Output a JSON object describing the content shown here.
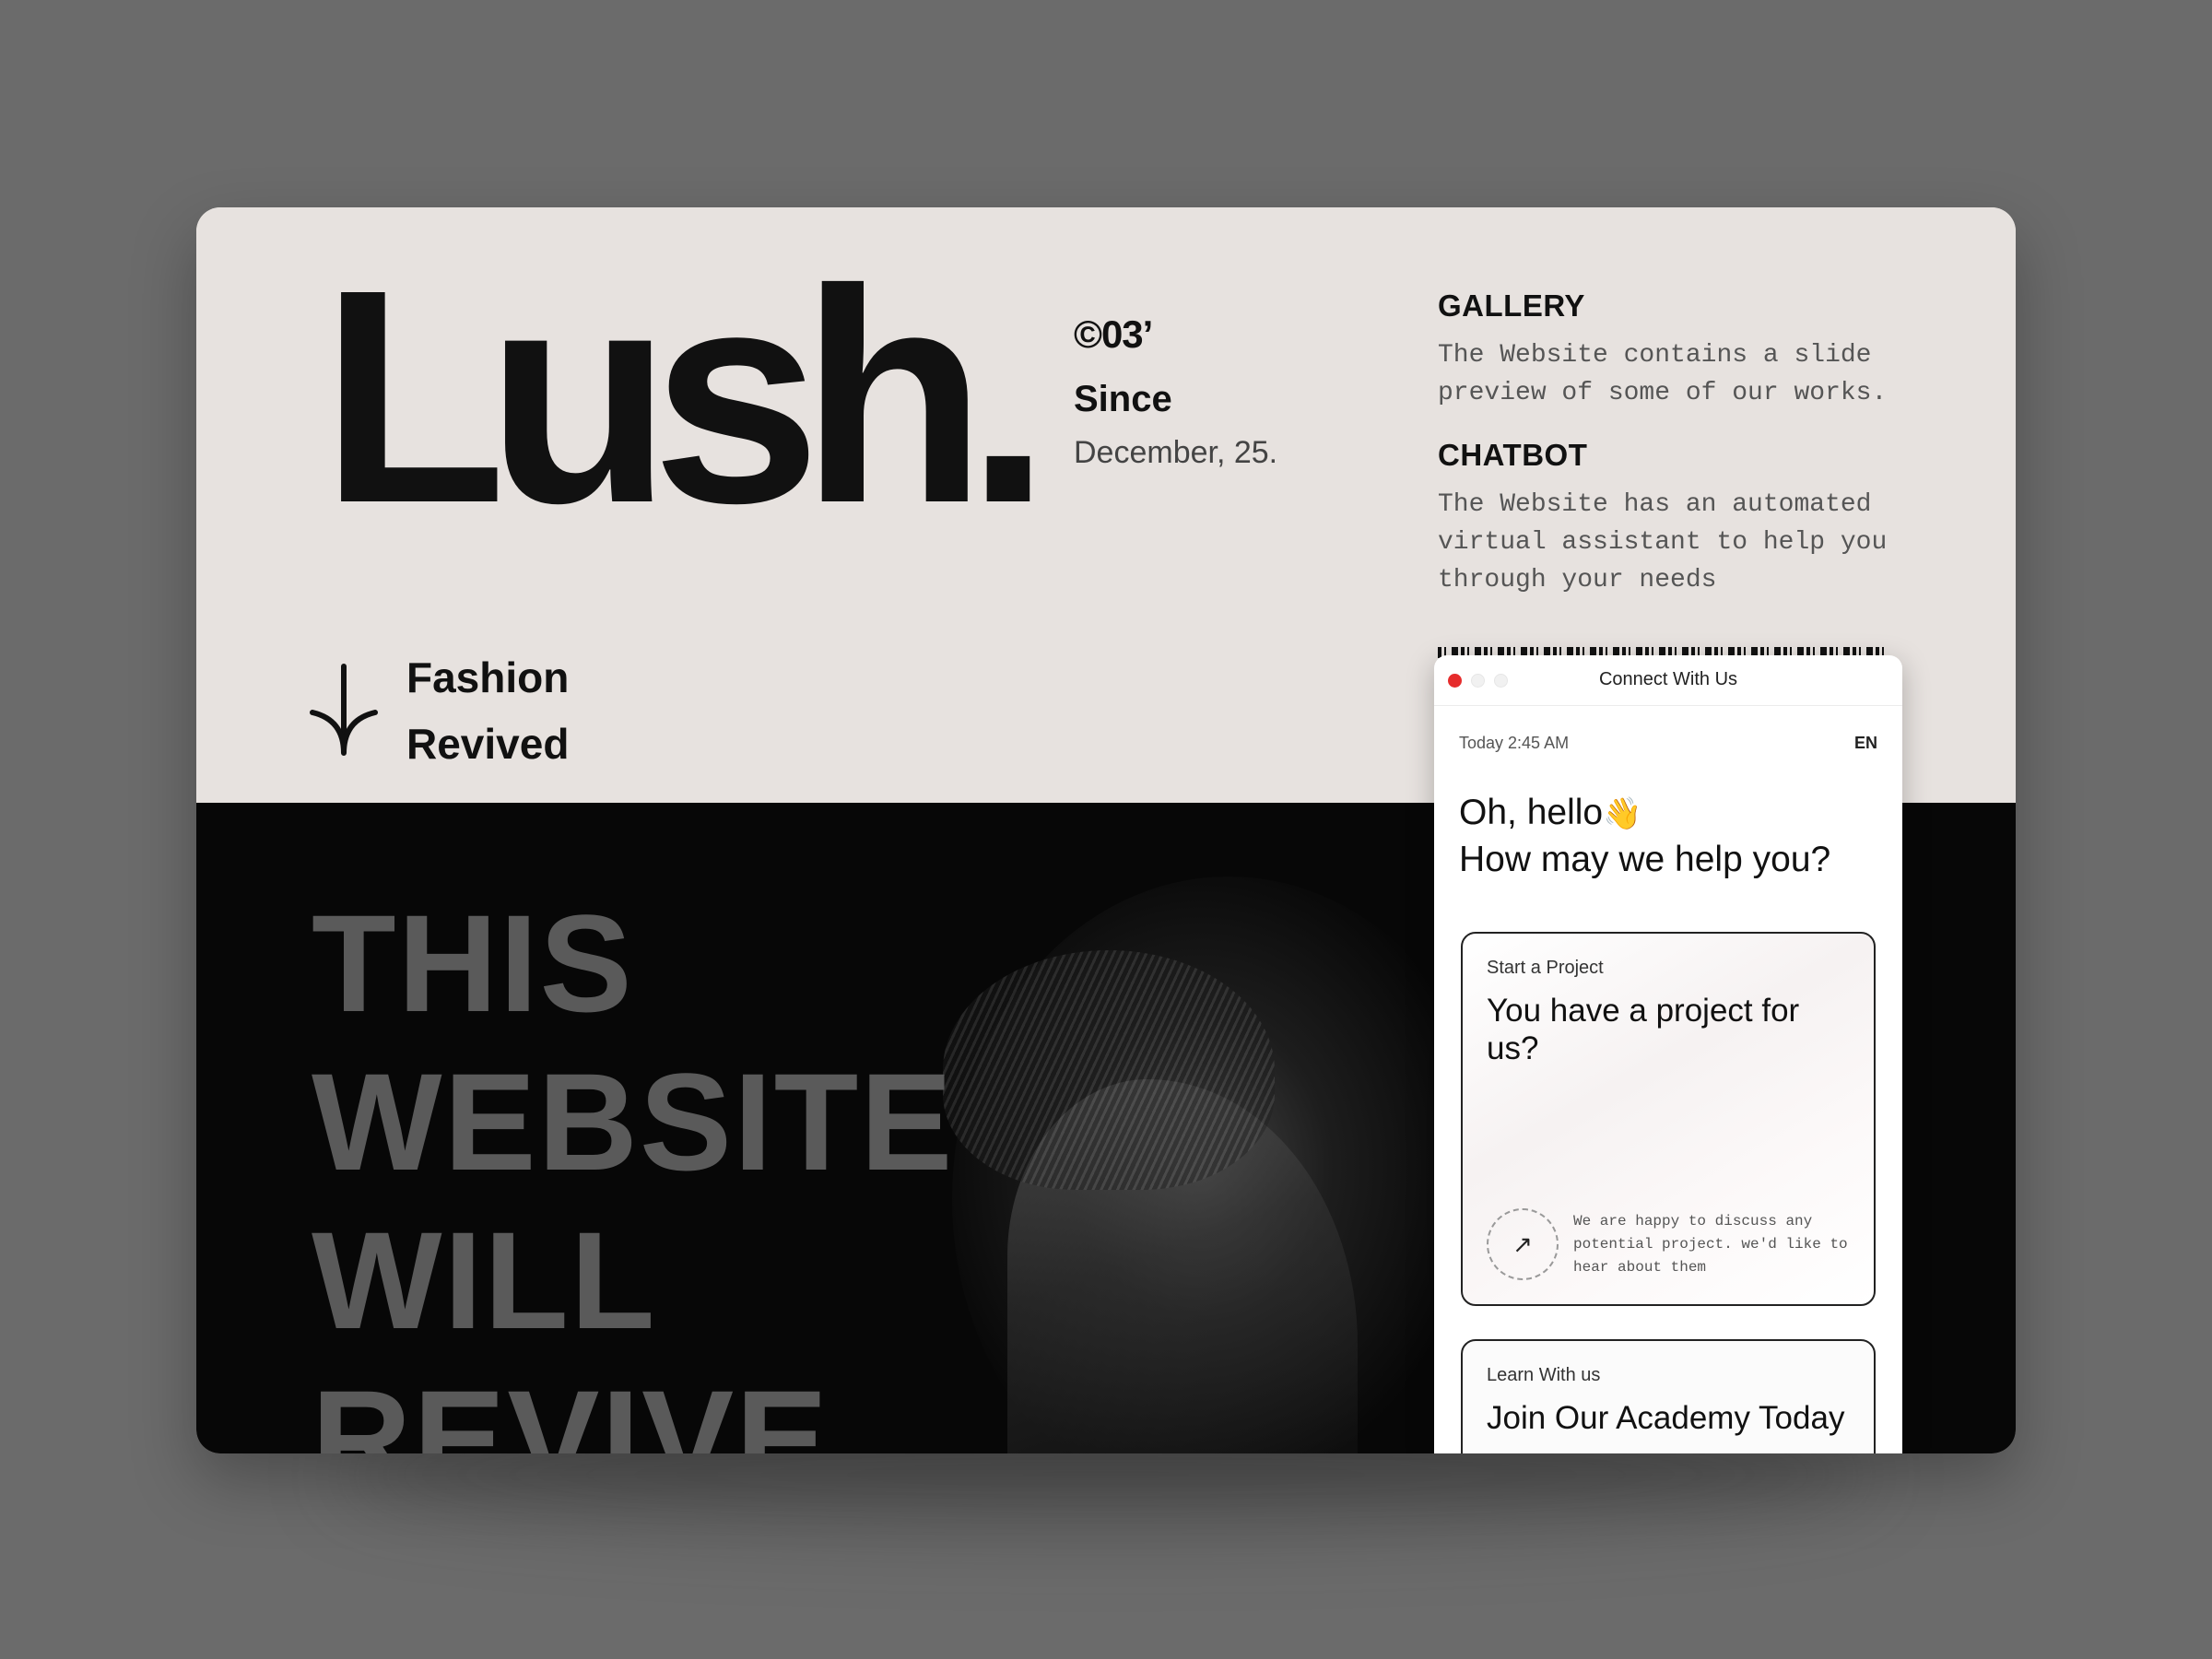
{
  "brand": {
    "logo": "Lush.",
    "code": "©03’",
    "since_label": "Since",
    "since_date": "December, 25."
  },
  "features": [
    {
      "title": "GALLERY",
      "text": "The Website contains a slide preview of some of our works."
    },
    {
      "title": "CHATBOT",
      "text": "The Website has an automated virtual assistant to help you through your needs"
    }
  ],
  "tagline": {
    "line1": "Fashion",
    "line2": "Revived",
    "icon": "arrow-down-icon"
  },
  "hero": {
    "lines": [
      "THIS",
      "WEBSITE",
      "WILL",
      "REVIVE"
    ]
  },
  "chat": {
    "title": "Connect With Us",
    "timestamp": "Today 2:45 AM",
    "language": "EN",
    "greeting_line1": "Oh, hello",
    "greeting_emoji": "👋",
    "greeting_line2": "How may we help you?",
    "cards": [
      {
        "label": "Start a Project",
        "title": "You have a project for us?",
        "description": "We are happy to discuss any potential project. we'd like to hear about them",
        "icon": "arrow-up-right-icon"
      },
      {
        "label": "Learn With us",
        "title": "Join Our Academy Today"
      }
    ]
  },
  "colors": {
    "background": "#6b6b6b",
    "panel_light": "#e7e2df",
    "panel_dark": "#070707",
    "accent_red": "#e62c2c"
  }
}
